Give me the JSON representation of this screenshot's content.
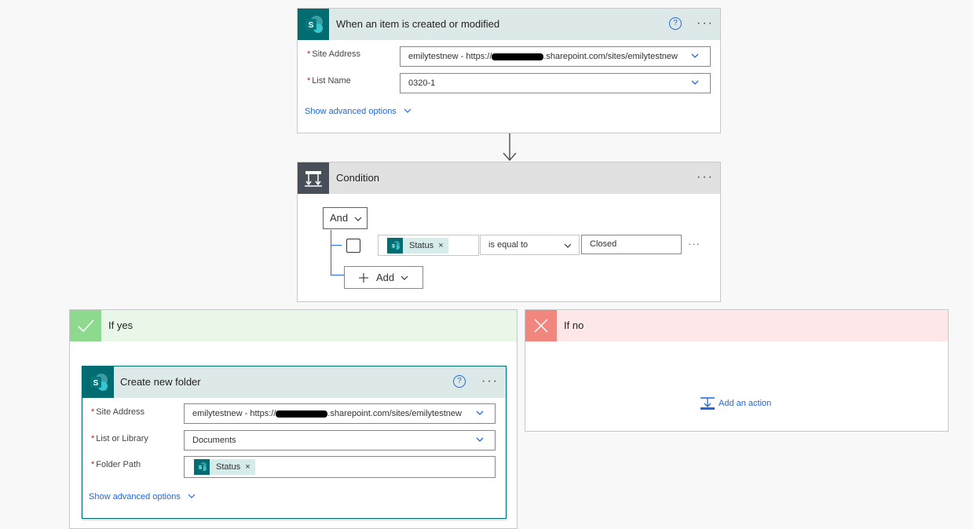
{
  "trigger": {
    "title": "When an item is created or modified",
    "help": "?",
    "menu": "···",
    "site_label": "Site Address",
    "site_value_prefix": "emilytestnew - https://",
    "site_value_suffix": ".sharepoint.com/sites/emilytestnew",
    "list_label": "List Name",
    "list_value": "0320-1",
    "advanced": "Show advanced options"
  },
  "condition": {
    "title": "Condition",
    "menu": "···",
    "group_operator": "And",
    "row": {
      "token": "Status",
      "token_remove": "×",
      "operator": "is equal to",
      "value": "Closed",
      "more": "···"
    },
    "add_label": "Add"
  },
  "yes_branch": {
    "title": "If yes",
    "action": {
      "title": "Create new folder",
      "help": "?",
      "menu": "···",
      "site_label": "Site Address",
      "site_value_prefix": "emilytestnew - https://",
      "site_value_suffix": ".sharepoint.com/sites/emilytestnew",
      "library_label": "List or Library",
      "library_value": "Documents",
      "folder_label": "Folder Path",
      "folder_token": "Status",
      "folder_token_remove": "×",
      "advanced": "Show advanced options"
    }
  },
  "no_branch": {
    "title": "If no",
    "add_action": "Add an action"
  },
  "colors": {
    "sharepoint": "#036c70",
    "trigger_header": "#dde8e8",
    "condition_header": "#e1e1e1",
    "condition_icon": "#484f58",
    "yes_header": "#e9f7e9",
    "yes_icon": "#8dd98d",
    "no_header": "#fde7e9",
    "no_icon": "#f1867e",
    "link": "#2266e3"
  },
  "icons": [
    "sharepoint-icon",
    "condition-icon",
    "check-icon",
    "cross-icon",
    "help-icon",
    "chevron-down-icon",
    "add-action-icon"
  ]
}
